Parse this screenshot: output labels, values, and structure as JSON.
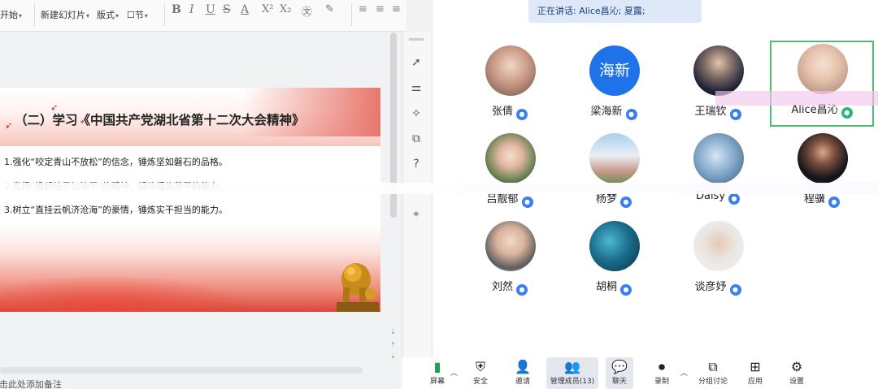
{
  "ppt": {
    "ribbon": {
      "start": "开始",
      "new_slide": "新建幻灯片",
      "layout": "版式",
      "section": "节",
      "font_buttons": [
        "B",
        "I",
        "U",
        "S",
        "A",
        "X²",
        "X₂",
        "㉆"
      ]
    },
    "slide": {
      "title": "（二）学习《中国共产党湖北省第十二次大会精神》",
      "lines": [
        "1.强化“咬定青山不放松”的信念，锤炼坚如磐石的品格。",
        "2.发扬“撸起袖子加油干”的精神，锤炼埋头苦干的能力。",
        "3.树立“直挂云帆济沧海”的豪情，锤炼实干担当的能力。"
      ]
    },
    "notes_placeholder": "单击此处添加备注"
  },
  "meeting": {
    "speaking": "正在讲话: Alice昌沁; 夏露;",
    "participants": [
      {
        "name": "张倩",
        "avatar_text": ""
      },
      {
        "name": "梁海新",
        "avatar_text": "海新"
      },
      {
        "name": "王瑞钦",
        "avatar_text": ""
      },
      {
        "name": "Alice昌沁",
        "avatar_text": ""
      },
      {
        "name": "吕靓郁",
        "avatar_text": ""
      },
      {
        "name": "杨梦",
        "avatar_text": ""
      },
      {
        "name": "Daisy",
        "avatar_text": ""
      },
      {
        "name": "程骥",
        "avatar_text": ""
      },
      {
        "name": "刘然",
        "avatar_text": ""
      },
      {
        "name": "胡桐",
        "avatar_text": ""
      },
      {
        "name": "谈彦妤",
        "avatar_text": ""
      }
    ],
    "toolbar": {
      "share": "屏幕",
      "security": "安全",
      "invite": "邀请",
      "members": "管理成员(13)",
      "chat": "聊天",
      "record": "录制",
      "breakout": "分组讨论",
      "apps": "应用",
      "settings": "设置"
    }
  },
  "colors": {
    "accent": "#3a7ff0",
    "active_speaker": "#4dbe72",
    "slide_red": "#d9463a"
  }
}
